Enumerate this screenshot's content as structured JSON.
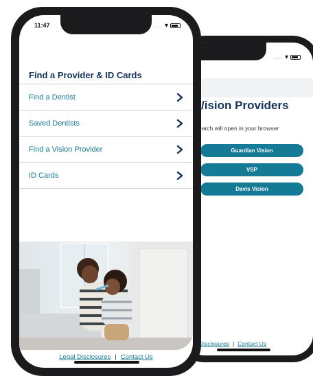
{
  "front": {
    "status_time": "11:47",
    "status_dots": "....",
    "heading": "Find a Provider & ID Cards",
    "menu": [
      {
        "label": "Find a Dentist"
      },
      {
        "label": "Saved Dentists"
      },
      {
        "label": "Find a Vision Provider"
      },
      {
        "label": "ID Cards"
      }
    ],
    "footer": {
      "legal": "Legal Disclosures",
      "separator": "|",
      "contact": "Contact Us"
    }
  },
  "back": {
    "status_dots": "....",
    "title": "Vision Providers",
    "title_visible": "/ision Providers",
    "note": "earch will open in your browser",
    "buttons": [
      {
        "label": "Guardian Vision"
      },
      {
        "label": "VSP"
      },
      {
        "label": "Davis Vision"
      }
    ],
    "footer": {
      "legal": "Disclosures",
      "separator": "|",
      "contact": "Contact Us"
    }
  },
  "colors": {
    "heading": "#14325a",
    "link": "#157a96",
    "button": "#157a96",
    "divider": "#c8d4d8"
  },
  "icons": {
    "chevron": "chevron-right-icon",
    "wifi": "wifi-icon",
    "battery": "battery-icon"
  }
}
